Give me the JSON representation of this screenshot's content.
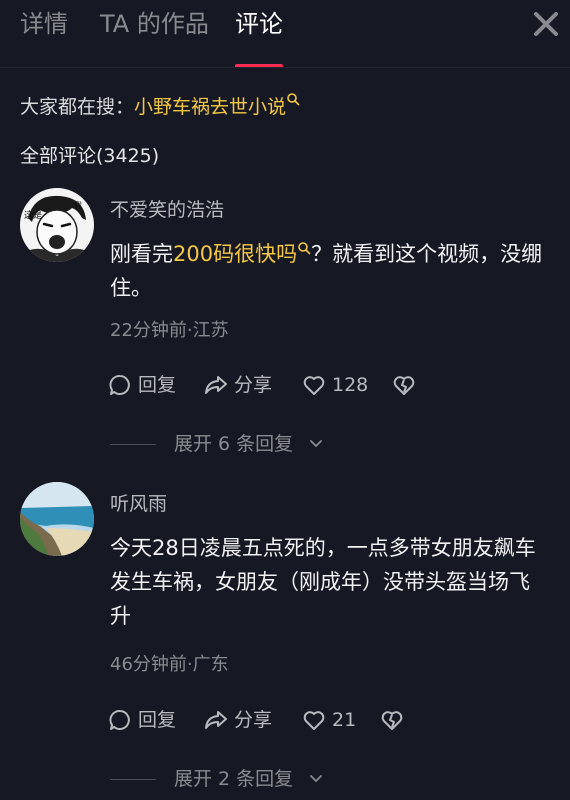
{
  "tabs": [
    {
      "label": "详情",
      "active": false
    },
    {
      "label": "TA 的作品",
      "active": false
    },
    {
      "label": "评论",
      "active": true
    }
  ],
  "search_hint": {
    "prefix": "大家都在搜：",
    "term": "小野车祸去世小说"
  },
  "comment_count_label": "全部评论(3425)",
  "comments": [
    {
      "username": "不爱笑的浩浩",
      "avatar_icon": "manga-character-avatar",
      "text_before": "刚看完",
      "highlight": "200码很快吗",
      "text_after": "？就看到这个视频，没绷住。",
      "meta": "22分钟前·江苏",
      "reply_label": "回复",
      "share_label": "分享",
      "likes": "128",
      "expand_label": "展开 6 条回复"
    },
    {
      "username": "听风雨",
      "avatar_icon": "seaside-landscape-avatar",
      "text": "今天28日凌晨五点死的，一点多带女朋友飙车发生车祸，女朋友（刚成年）没带头盔当场飞升",
      "meta": "46分钟前·广东",
      "reply_label": "回复",
      "share_label": "分享",
      "likes": "21",
      "expand_label": "展开 2 条回复"
    }
  ],
  "colors": {
    "background": "#161823",
    "accent": "#fe2c55",
    "highlight": "#f5c842",
    "muted": "#8a8b91"
  }
}
